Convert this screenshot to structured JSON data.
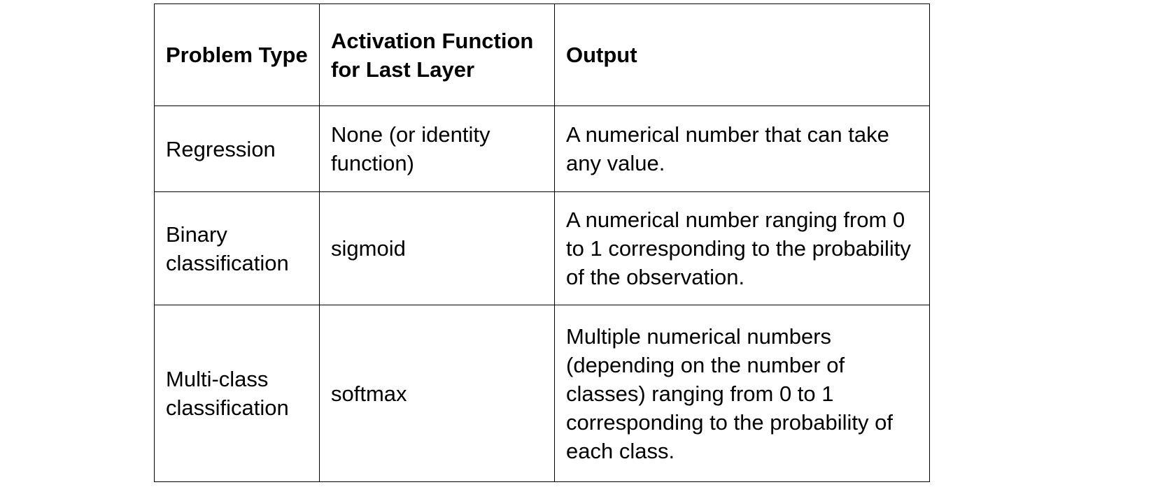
{
  "table": {
    "headers": [
      "Problem Type",
      "Activation Function for Last Layer",
      "Output"
    ],
    "rows": [
      [
        "Regression",
        "None (or identity function)",
        "A numerical number that can take any value."
      ],
      [
        "Binary classification",
        "sigmoid",
        "A numerical number ranging from 0 to 1 corresponding to the probability of the observation."
      ],
      [
        "Multi-class classification",
        "softmax",
        "Multiple numerical numbers (depending on the number of classes) ranging from 0 to 1 corresponding to the probability of each class."
      ]
    ]
  }
}
